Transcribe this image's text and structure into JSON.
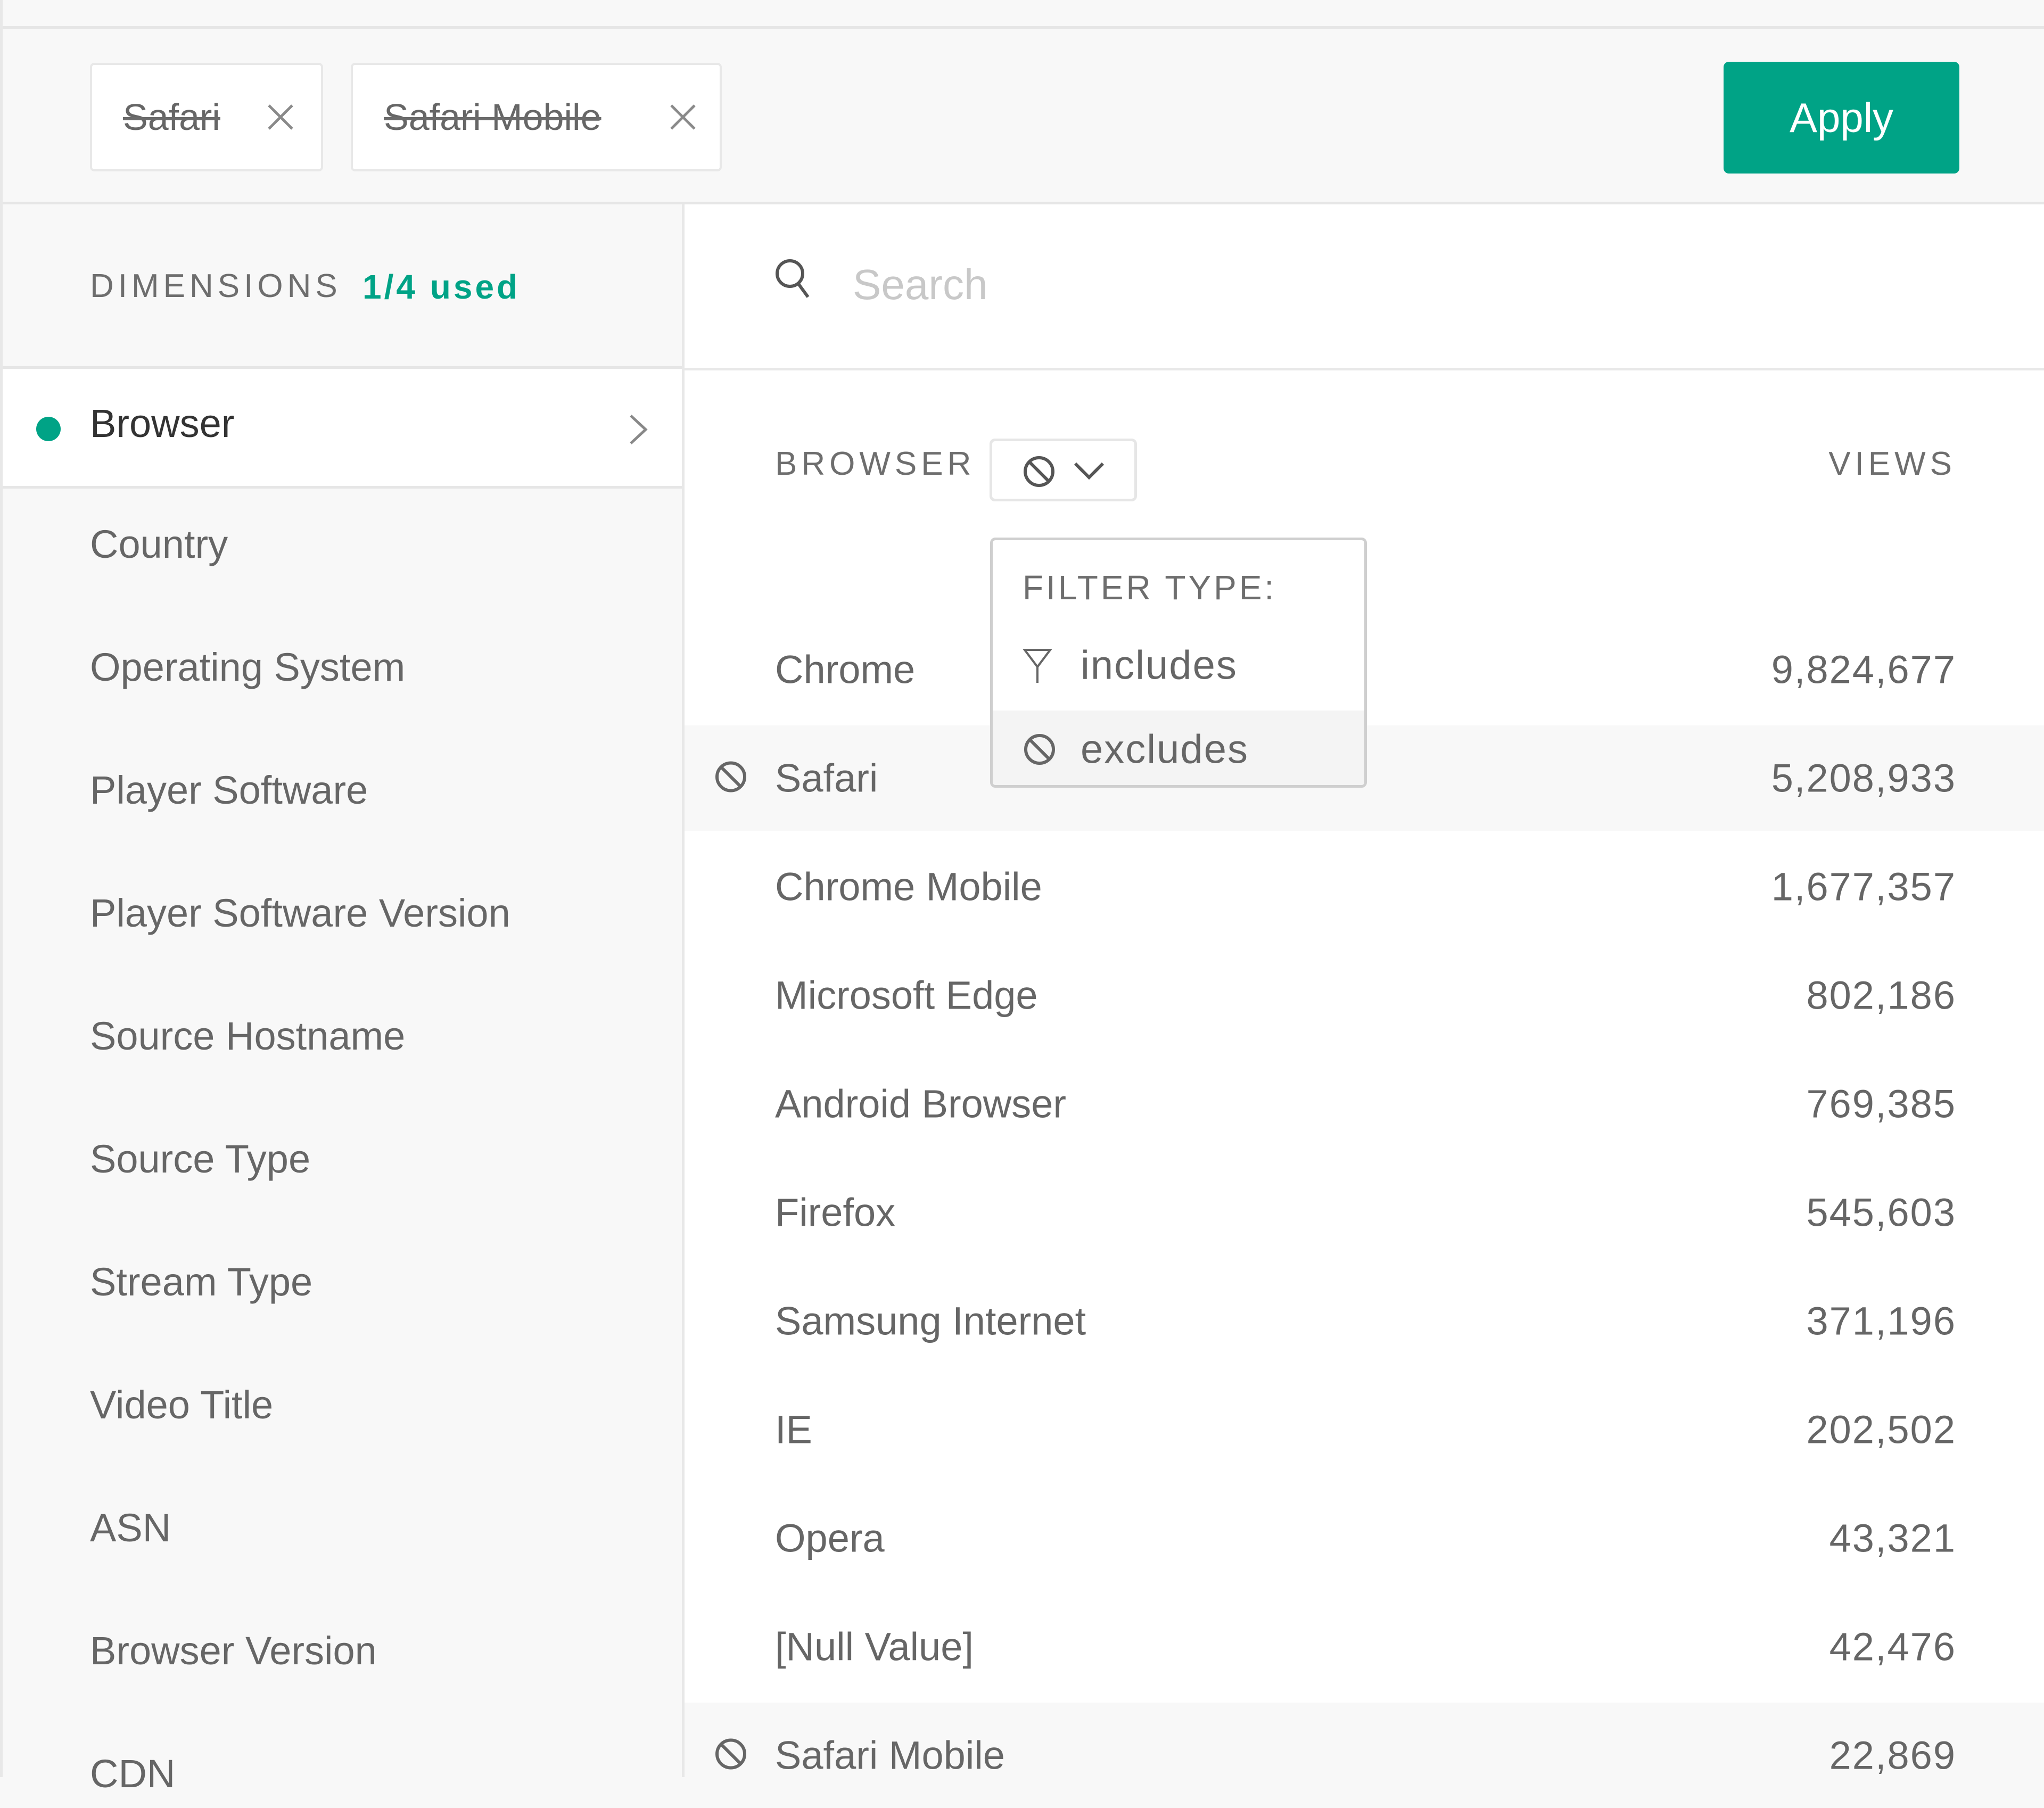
{
  "filter_chips": [
    {
      "label": "Safari",
      "mode": "excludes",
      "remove_icon": "close-icon"
    },
    {
      "label": "Safari Mobile",
      "mode": "excludes",
      "remove_icon": "close-icon"
    }
  ],
  "apply_button": {
    "label": "Apply"
  },
  "colors": {
    "accent": "#00a386",
    "text": "#666666",
    "header_text": "#6e6e6e",
    "excluded_row_bg": "#f8f8f8"
  },
  "sidebar": {
    "title": "DIMENSIONS",
    "used_count": "1/4 used",
    "active_item": {
      "label": "Browser",
      "status_icon": "dot-icon",
      "chevron": "chevron-right-icon"
    },
    "items": [
      {
        "label": "Country"
      },
      {
        "label": "Operating System"
      },
      {
        "label": "Player Software"
      },
      {
        "label": "Player Software Version"
      },
      {
        "label": "Source Hostname"
      },
      {
        "label": "Source Type"
      },
      {
        "label": "Stream Type"
      },
      {
        "label": "Video Title"
      },
      {
        "label": "ASN"
      },
      {
        "label": "Browser Version"
      },
      {
        "label": "CDN"
      }
    ]
  },
  "search": {
    "placeholder": "Search",
    "value": "",
    "icon": "search-icon"
  },
  "table": {
    "columns": {
      "name": "BROWSER",
      "value": "VIEWS"
    },
    "filter_type_toggle": {
      "current": "excludes",
      "icon": "ban-icon",
      "chevron": "chevron-down-icon"
    },
    "rows": [
      {
        "name": "Chrome",
        "views": "9,824,677",
        "excluded": false
      },
      {
        "name": "Safari",
        "views": "5,208,933",
        "excluded": true
      },
      {
        "name": "Chrome Mobile",
        "views": "1,677,357",
        "excluded": false
      },
      {
        "name": "Microsoft Edge",
        "views": "802,186",
        "excluded": false
      },
      {
        "name": "Android Browser",
        "views": "769,385",
        "excluded": false
      },
      {
        "name": "Firefox",
        "views": "545,603",
        "excluded": false
      },
      {
        "name": "Samsung Internet",
        "views": "371,196",
        "excluded": false
      },
      {
        "name": "IE",
        "views": "202,502",
        "excluded": false
      },
      {
        "name": "Opera",
        "views": "43,321",
        "excluded": false
      },
      {
        "name": "[Null Value]",
        "views": "42,476",
        "excluded": false
      },
      {
        "name": "Safari Mobile",
        "views": "22,869",
        "excluded": true
      }
    ]
  },
  "filter_type_dropdown": {
    "title": "FILTER TYPE:",
    "options": [
      {
        "label": "includes",
        "icon": "filter-funnel-icon",
        "selected": false
      },
      {
        "label": "excludes",
        "icon": "ban-icon",
        "selected": true
      }
    ]
  }
}
